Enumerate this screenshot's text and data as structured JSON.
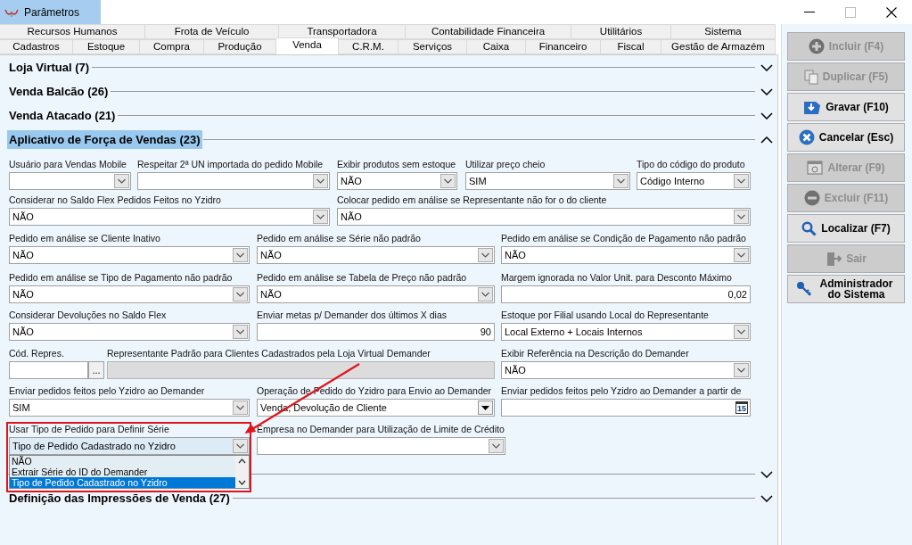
{
  "window": {
    "title": "Parâmetros"
  },
  "tab_rows": [
    [
      {
        "label": "Recursos Humanos",
        "selected": false
      },
      {
        "label": "Frota de Veículo",
        "selected": false
      },
      {
        "label": "Transportadora",
        "selected": false
      },
      {
        "label": "Contabilidade Financeira",
        "selected": false
      },
      {
        "label": "Utilitários",
        "selected": false
      },
      {
        "label": "Sistema",
        "selected": false
      }
    ],
    [
      {
        "label": "Cadastros",
        "selected": false
      },
      {
        "label": "Estoque",
        "selected": false
      },
      {
        "label": "Compra",
        "selected": false
      },
      {
        "label": "Produção",
        "selected": false
      },
      {
        "label": "Venda",
        "selected": true
      },
      {
        "label": "C.R.M.",
        "selected": false
      },
      {
        "label": "Serviços",
        "selected": false
      },
      {
        "label": "Caixa",
        "selected": false
      },
      {
        "label": "Financeiro",
        "selected": false
      },
      {
        "label": "Fiscal",
        "selected": false
      },
      {
        "label": "Gestão de Armazém",
        "selected": false
      }
    ]
  ],
  "sections": [
    {
      "title": "Loja Virtual (7)",
      "expanded": false,
      "selected": false
    },
    {
      "title": "Venda Balcão (26)",
      "expanded": false,
      "selected": false
    },
    {
      "title": "Venda Atacado (21)",
      "expanded": false,
      "selected": false
    },
    {
      "title": "Aplicativo de Força de Vendas (23)",
      "expanded": true,
      "selected": true,
      "fields": [
        {
          "label": "Usuário para Vendas Mobile",
          "kind": "combo"
        },
        {
          "label": "Respeitar 2ª UN importada do pedido Mobile",
          "kind": "combo"
        },
        {
          "label": "Exibir produtos sem estoque",
          "kind": "combo",
          "value": "NÃO"
        },
        {
          "label": "Utilizar preço cheio",
          "kind": "combo",
          "value": "SIM"
        },
        {
          "label": "Tipo do código do produto",
          "kind": "combo",
          "value": "Código Interno"
        },
        {
          "label": "Considerar no Saldo Flex Pedidos Feitos no Yzidro",
          "kind": "combo",
          "value": "NÃO"
        },
        {
          "label": "Colocar pedido em análise se Representante não for o do cliente",
          "kind": "combo",
          "value": "NÃO"
        },
        {
          "label": "Pedido em análise se Cliente Inativo",
          "kind": "combo",
          "value": "NÃO"
        },
        {
          "label": "Pedido em análise se Série não padrão",
          "kind": "combo",
          "value": "NÃO"
        },
        {
          "label": "Pedido em análise se Condição de Pagamento não padrão",
          "kind": "combo",
          "value": "NÃO"
        },
        {
          "label": "Pedido em análise se Tipo de Pagamento não padrão",
          "kind": "combo",
          "value": "NÃO"
        },
        {
          "label": "Pedido em análise se Tabela de Preço não padrão",
          "kind": "combo",
          "value": "NÃO"
        },
        {
          "label": "Margem ignorada no Valor Unit. para Desconto Máximo",
          "kind": "number",
          "value": "0,02"
        },
        {
          "label": "Considerar Devoluções no Saldo Flex",
          "kind": "combo",
          "value": "NÃO"
        },
        {
          "label": "Enviar metas p/ Demander dos últimos X dias",
          "kind": "number",
          "value": "90"
        },
        {
          "label": "Estoque por Filial usando Local do Representante",
          "kind": "combo",
          "value": "Local Externo + Locais Internos"
        },
        {
          "label": "Cód. Repres.",
          "kind": "lookup",
          "button_text": "..."
        },
        {
          "label": "Representante Padrão para Clientes Cadastrados pela Loja Virtual Demander",
          "kind": "readonly"
        },
        {
          "label": "Exibir Referência na Descrição do Demander",
          "kind": "combo",
          "value": "NÃO"
        },
        {
          "label": "Enviar pedidos feitos pelo Yzidro ao Demander",
          "kind": "combo",
          "value": "SIM"
        },
        {
          "label": "Operação de Pedido do Yzidro para Envio ao Demander",
          "kind": "dropdown",
          "value": "Venda, Devolução de Cliente"
        },
        {
          "label": "Enviar pedidos feitos pelo Yzidro ao Demander a partir de",
          "kind": "date",
          "calendar_label": "15"
        },
        {
          "label": "Usar Tipo de Pedido para Definir Série",
          "kind": "combo",
          "value": "Tipo de Pedido Cadastrado no Yzidro",
          "focused": true,
          "highlight": true,
          "options": [
            {
              "label": "NÃO",
              "selected": false
            },
            {
              "label": "Extrair Série do ID do Demander",
              "selected": false
            },
            {
              "label": "Tipo de Pedido Cadastrado no Yzidro",
              "selected": true
            }
          ]
        },
        {
          "label": "Empresa no Demander para Utilização de Limite de Crédito",
          "kind": "combo"
        }
      ]
    },
    {
      "expanded": false
    },
    {
      "title": "Definição das Impressões de Venda (27)",
      "expanded": false,
      "selected": false
    }
  ],
  "buttons": [
    {
      "label": "Incluir (F4)",
      "kind": "add",
      "disabled": true
    },
    {
      "label": "Duplicar (F5)",
      "kind": "copy",
      "disabled": true
    },
    {
      "label": "Gravar (F10)",
      "kind": "save",
      "disabled": false
    },
    {
      "label": "Cancelar (Esc)",
      "kind": "cancel",
      "disabled": false
    },
    {
      "label": "Alterar (F9)",
      "kind": "edit",
      "disabled": true
    },
    {
      "label": "Excluir (F11)",
      "kind": "delete",
      "disabled": true
    },
    {
      "label": "Localizar (F7)",
      "kind": "find",
      "disabled": false
    },
    {
      "label": "Sair",
      "kind": "exit",
      "disabled": true
    },
    {
      "label": "Administrador do Sistema",
      "kind": "admin",
      "disabled": false
    }
  ]
}
